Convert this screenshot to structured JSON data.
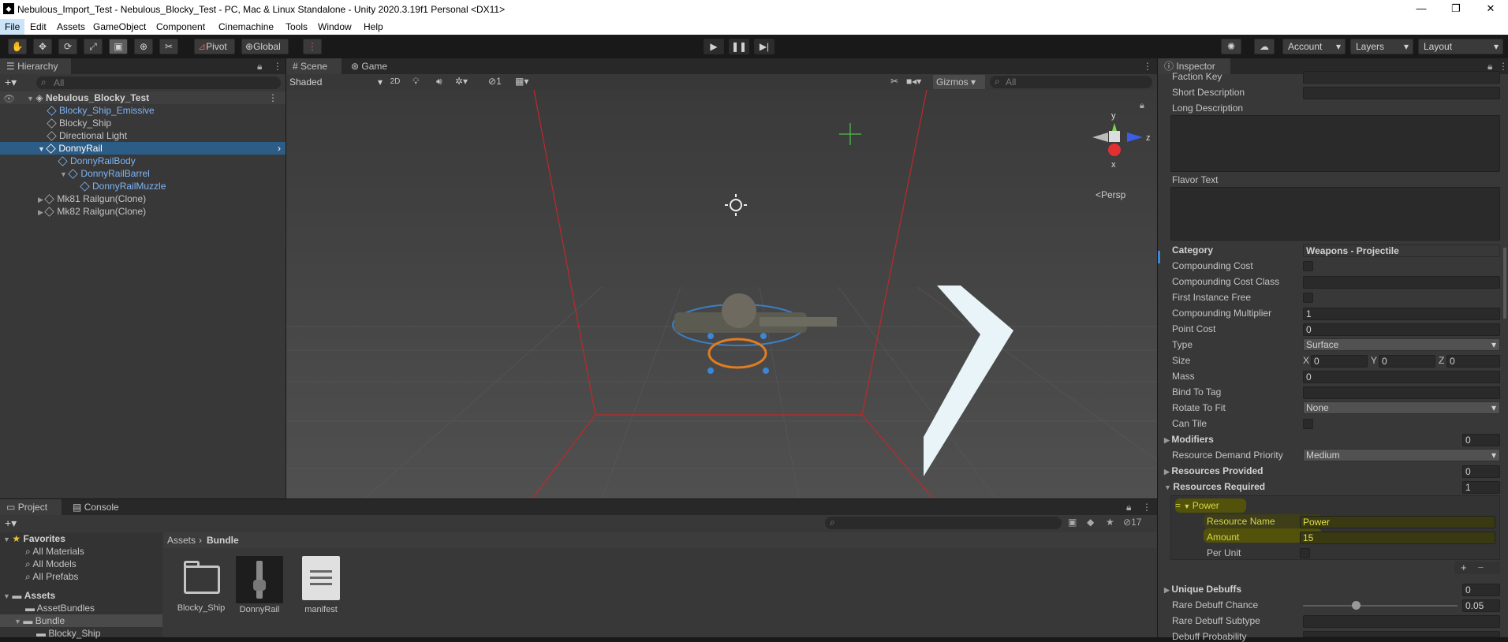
{
  "window": {
    "title": "Nebulous_Import_Test - Nebulous_Blocky_Test - PC, Mac & Linux Standalone - Unity 2020.3.19f1 Personal <DX11>",
    "minimize": "—",
    "restore": "❐",
    "close": "✕"
  },
  "menu": [
    "File",
    "Edit",
    "Assets",
    "GameObject",
    "Component",
    "Cinemachine",
    "Tools",
    "Window",
    "Help"
  ],
  "toolbar": {
    "pivot": "Pivot",
    "global": "Global",
    "account": "Account",
    "layers": "Layers",
    "layout": "Layout"
  },
  "hierarchy": {
    "tab": "Hierarchy",
    "search_placeholder": "All",
    "scene": "Nebulous_Blocky_Test",
    "items": [
      "Blocky_Ship_Emissive",
      "Blocky_Ship",
      "Directional Light",
      "DonnyRail",
      "DonnyRailBody",
      "DonnyRailBarrel",
      "DonnyRailMuzzle",
      "Mk81 Railgun(Clone)",
      "Mk82 Railgun(Clone)"
    ]
  },
  "scene_view": {
    "tab_scene": "Scene",
    "tab_game": "Game",
    "shading": "Shaded",
    "mode2d": "2D",
    "hidden_count": "1",
    "gizmos": "Gizmos",
    "search_placeholder": "All",
    "persp": "<Persp",
    "axis_y": "y",
    "axis_z": "z",
    "axis_x": "x"
  },
  "project": {
    "tab_project": "Project",
    "tab_console": "Console",
    "favorites": "Favorites",
    "fav_items": [
      "All Materials",
      "All Models",
      "All Prefabs"
    ],
    "assets": "Assets",
    "asset_items": [
      "AssetBundles",
      "Bundle",
      "Blocky_Ship"
    ],
    "breadcrumb": [
      "Assets",
      "Bundle"
    ],
    "files": [
      "Blocky_Ship",
      "DonnyRail",
      "manifest"
    ],
    "hidden_count": "17"
  },
  "inspector": {
    "tab": "Inspector",
    "fields": [
      {
        "label": "Faction Key",
        "value": ""
      },
      {
        "label": "Short Description",
        "value": ""
      },
      {
        "label": "Long Description",
        "value": ""
      },
      {
        "label": "Flavor Text",
        "value": ""
      },
      {
        "label": "Category",
        "value": "Weapons - Projectile"
      },
      {
        "label": "Compounding Cost"
      },
      {
        "label": "Compounding Cost Class",
        "value": ""
      },
      {
        "label": "First Instance Free"
      },
      {
        "label": "Compounding Multiplier",
        "value": "1"
      },
      {
        "label": "Point Cost",
        "value": "0"
      },
      {
        "label": "Type",
        "value": "Surface"
      },
      {
        "label": "Size",
        "x": "0",
        "y": "0",
        "z": "0"
      },
      {
        "label": "Mass",
        "value": "0"
      },
      {
        "label": "Bind To Tag",
        "value": ""
      },
      {
        "label": "Rotate To Fit",
        "value": "None"
      },
      {
        "label": "Can Tile"
      },
      {
        "label": "Modifiers",
        "value": "0"
      },
      {
        "label": "Resource Demand Priority",
        "value": "Medium"
      },
      {
        "label": "Resources Provided",
        "value": "0"
      },
      {
        "label": "Resources Required",
        "value": "1"
      },
      {
        "label": "Power"
      },
      {
        "label": "Resource Name",
        "value": "Power"
      },
      {
        "label": "Amount",
        "value": "15"
      },
      {
        "label": "Per Unit"
      },
      {
        "label": "Unique Debuffs",
        "value": "0"
      },
      {
        "label": "Rare Debuff Chance",
        "value": "0.05"
      },
      {
        "label": "Rare Debuff Subtype",
        "value": ""
      },
      {
        "label": "Debuff Probability",
        "value": ""
      }
    ],
    "size_labels": [
      "X",
      "Y",
      "Z"
    ],
    "add": "+",
    "remove": "−"
  }
}
